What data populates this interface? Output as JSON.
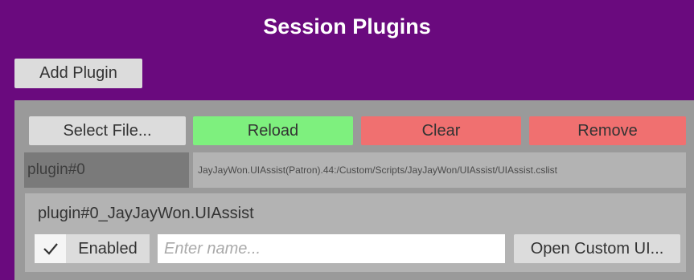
{
  "header": {
    "title": "Session Plugins"
  },
  "toolbar": {
    "add_plugin_label": "Add Plugin"
  },
  "plugin": {
    "select_file_label": "Select File...",
    "reload_label": "Reload",
    "clear_label": "Clear",
    "remove_label": "Remove",
    "id_label": "plugin#0",
    "path": "JayJayWon.UIAssist(Patron).44:/Custom/Scripts/JayJayWon/UIAssist/UIAssist.cslist",
    "sub": {
      "title": "plugin#0_JayJayWon.UIAssist",
      "enabled_label": "Enabled",
      "enabled_checked": true,
      "name_value": "",
      "name_placeholder": "Enter name...",
      "open_ui_label": "Open Custom UI..."
    }
  },
  "colors": {
    "background": "#6a0a7e",
    "reload": "#7ef07e",
    "danger": "#f07070",
    "panel": "#9a9a9a"
  }
}
